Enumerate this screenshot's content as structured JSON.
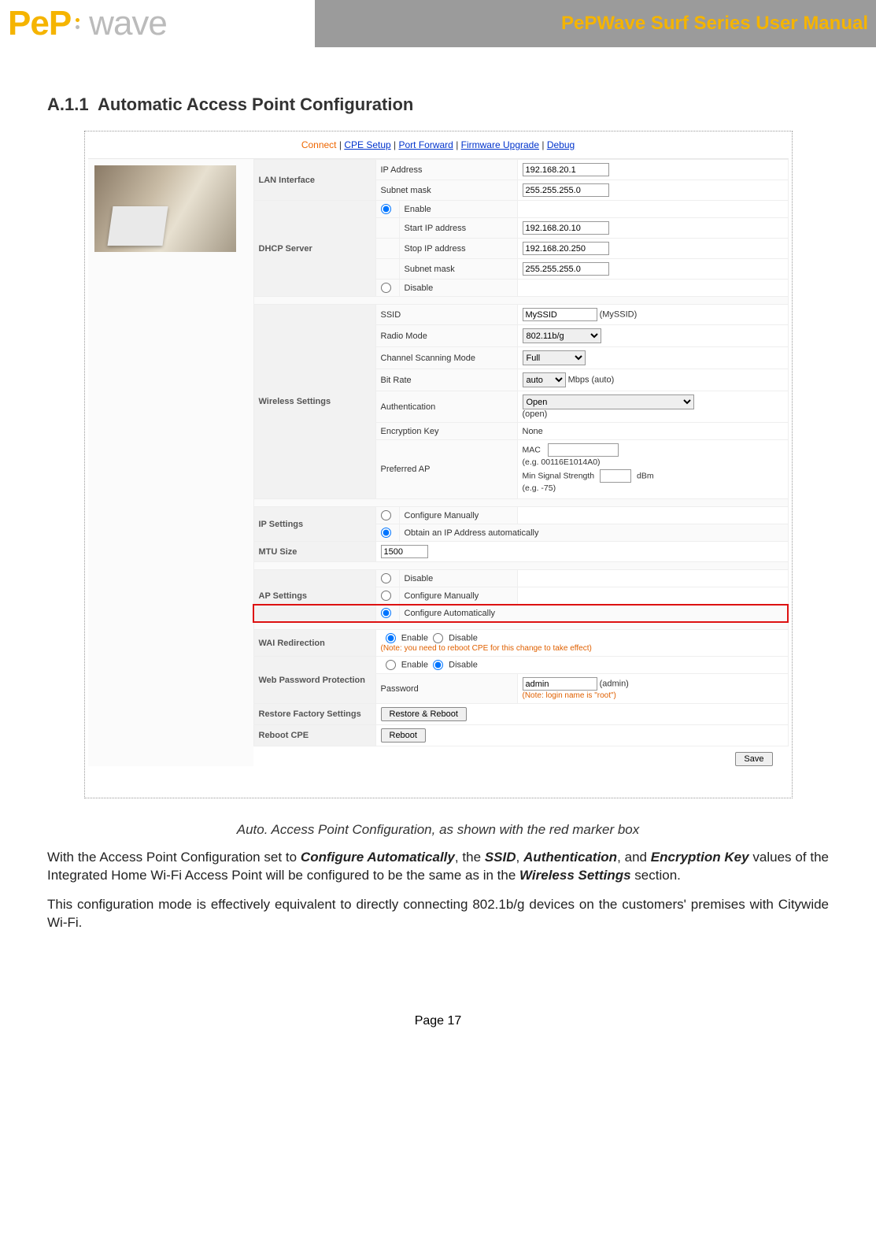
{
  "header": {
    "logo_pep": "PeP",
    "logo_wave": "wave",
    "title": "PePWave Surf Series User Manual"
  },
  "section": {
    "number": "A.1.1",
    "title": "Automatic Access Point Configuration"
  },
  "nav": {
    "connect": "Connect",
    "cpe_setup": "CPE Setup",
    "port_forward": "Port Forward",
    "firmware": "Firmware Upgrade",
    "debug": "Debug"
  },
  "lan": {
    "section": "LAN Interface",
    "ip_label": "IP Address",
    "ip_value": "192.168.20.1",
    "subnet_label": "Subnet mask",
    "subnet_value": "255.255.255.0"
  },
  "dhcp": {
    "section": "DHCP Server",
    "enable": "Enable",
    "start_label": "Start IP address",
    "start_value": "192.168.20.10",
    "stop_label": "Stop IP address",
    "stop_value": "192.168.20.250",
    "subnet_label": "Subnet mask",
    "subnet_value": "255.255.255.0",
    "disable": "Disable"
  },
  "wireless": {
    "section": "Wireless Settings",
    "ssid_label": "SSID",
    "ssid_value": "MySSID",
    "ssid_hint": "(MySSID)",
    "radio_label": "Radio Mode",
    "radio_value": "802.11b/g",
    "scan_label": "Channel Scanning Mode",
    "scan_value": "Full",
    "bitrate_label": "Bit Rate",
    "bitrate_value": "auto",
    "bitrate_hint": "Mbps (auto)",
    "auth_label": "Authentication",
    "auth_value": "Open",
    "auth_hint": "(open)",
    "enc_label": "Encryption Key",
    "enc_value": "None",
    "pref_label": "Preferred AP",
    "mac_label": "MAC",
    "mac_hint": "(e.g. 00116E1014A0)",
    "strength_label": "Min Signal Strength",
    "strength_unit": "dBm",
    "strength_hint": "(e.g. -75)"
  },
  "ip": {
    "section": "IP Settings",
    "manual": "Configure Manually",
    "auto": "Obtain an IP Address automatically"
  },
  "mtu": {
    "section": "MTU Size",
    "value": "1500"
  },
  "ap": {
    "section": "AP Settings",
    "disable": "Disable",
    "manual": "Configure Manually",
    "auto": "Configure Automatically"
  },
  "wai": {
    "section": "WAI Redirection",
    "enable": "Enable",
    "disable": "Disable",
    "note": "(Note: you need to reboot CPE for this change to take effect)"
  },
  "web": {
    "section": "Web Password Protection",
    "enable": "Enable",
    "disable": "Disable",
    "pass_label": "Password",
    "pass_value": "admin",
    "pass_hint": "(admin)",
    "note": "(Note: login name is \"root\")"
  },
  "restore": {
    "section": "Restore Factory Settings",
    "button": "Restore & Reboot"
  },
  "reboot": {
    "section": "Reboot CPE",
    "button": "Reboot"
  },
  "save": "Save",
  "caption": "Auto. Access Point Configuration, as shown with the red marker box",
  "para1_a": "With the Access Point Configuration set to ",
  "para1_b": "Configure Automatically",
  "para1_c": ", the ",
  "para1_d": "SSID",
  "para1_e": ", ",
  "para1_f": "Authentication",
  "para1_g": ", and ",
  "para1_h": "Encryption Key",
  "para1_i": " values of the Integrated Home Wi-Fi Access Point will be configured to be the same as in the ",
  "para1_j": "Wireless Settings",
  "para1_k": " section.",
  "para2": "This configuration mode is effectively equivalent to directly connecting 802.1b/g devices on the customers' premises with Citywide Wi-Fi.",
  "footer": "Page 17"
}
